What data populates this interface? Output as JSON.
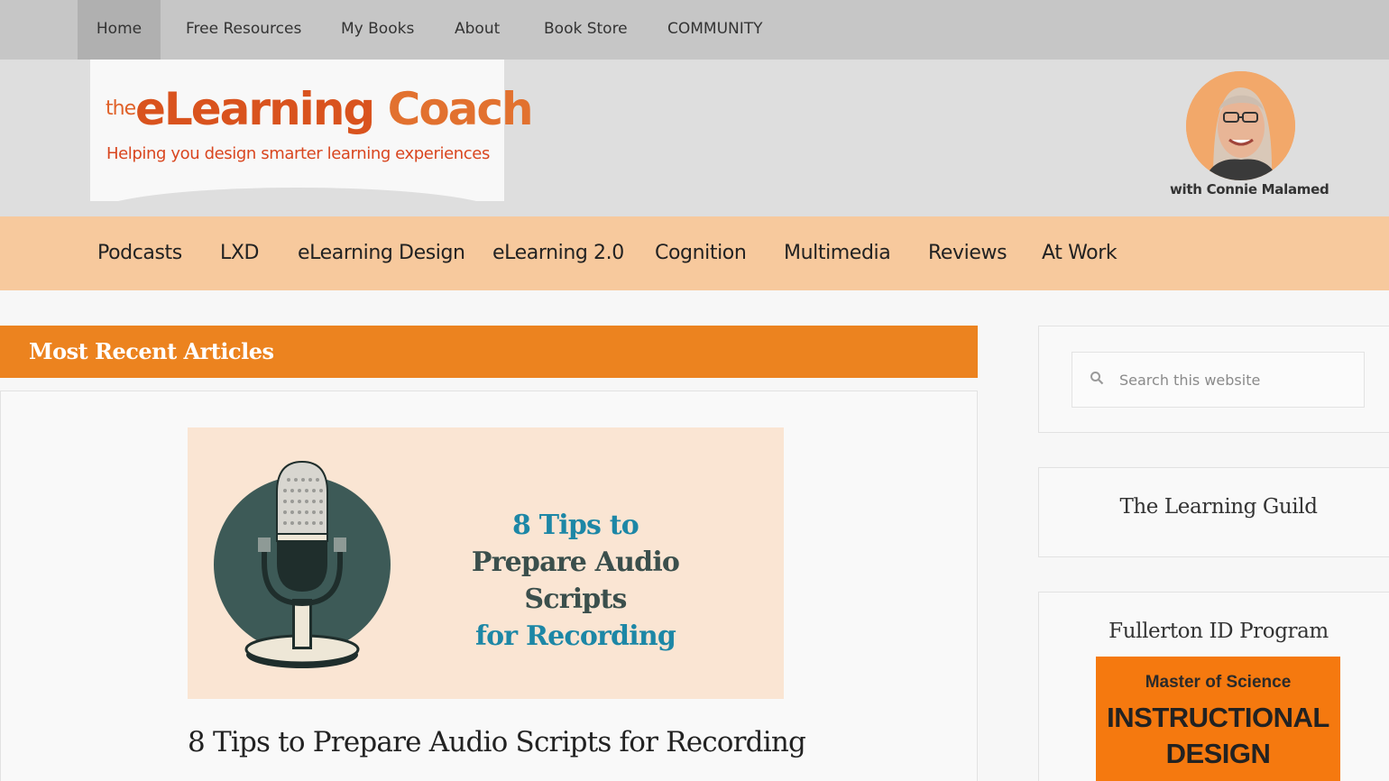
{
  "top_nav": {
    "items": [
      "Home",
      "Free Resources",
      "My Books",
      "About",
      "Book Store",
      "COMMUNITY"
    ],
    "active": "Home"
  },
  "header": {
    "logo_the": "the",
    "logo_main_a": "eLearning",
    "logo_main_b": "Coach",
    "tagline": "Helping you design smarter learning experiences",
    "author_caption": "with Connie Malamed"
  },
  "category_nav": {
    "items": [
      "Podcasts",
      "LXD",
      "eLearning Design",
      "eLearning 2.0",
      "Cognition",
      "Multimedia",
      "Reviews",
      "At Work"
    ]
  },
  "main": {
    "section_title": "Most Recent Articles",
    "feature_image": {
      "line1": "8 Tips to",
      "line2": "Prepare Audio Scripts",
      "line3": "for Recording"
    },
    "article_title": "8 Tips to Prepare Audio Scripts for Recording"
  },
  "sidebar": {
    "search_placeholder": "Search this website",
    "widget1_title": "The Learning Guild",
    "widget2_title": "Fullerton ID Program",
    "ad_line1": "Master of Science",
    "ad_line2": "INSTRUCTIONAL",
    "ad_line3": "DESIGN"
  },
  "colors": {
    "accent_orange": "#ec831f",
    "nav_peach": "#f7c99d",
    "logo_orange": "#d9531e",
    "feature_blue": "#1d87a6"
  }
}
